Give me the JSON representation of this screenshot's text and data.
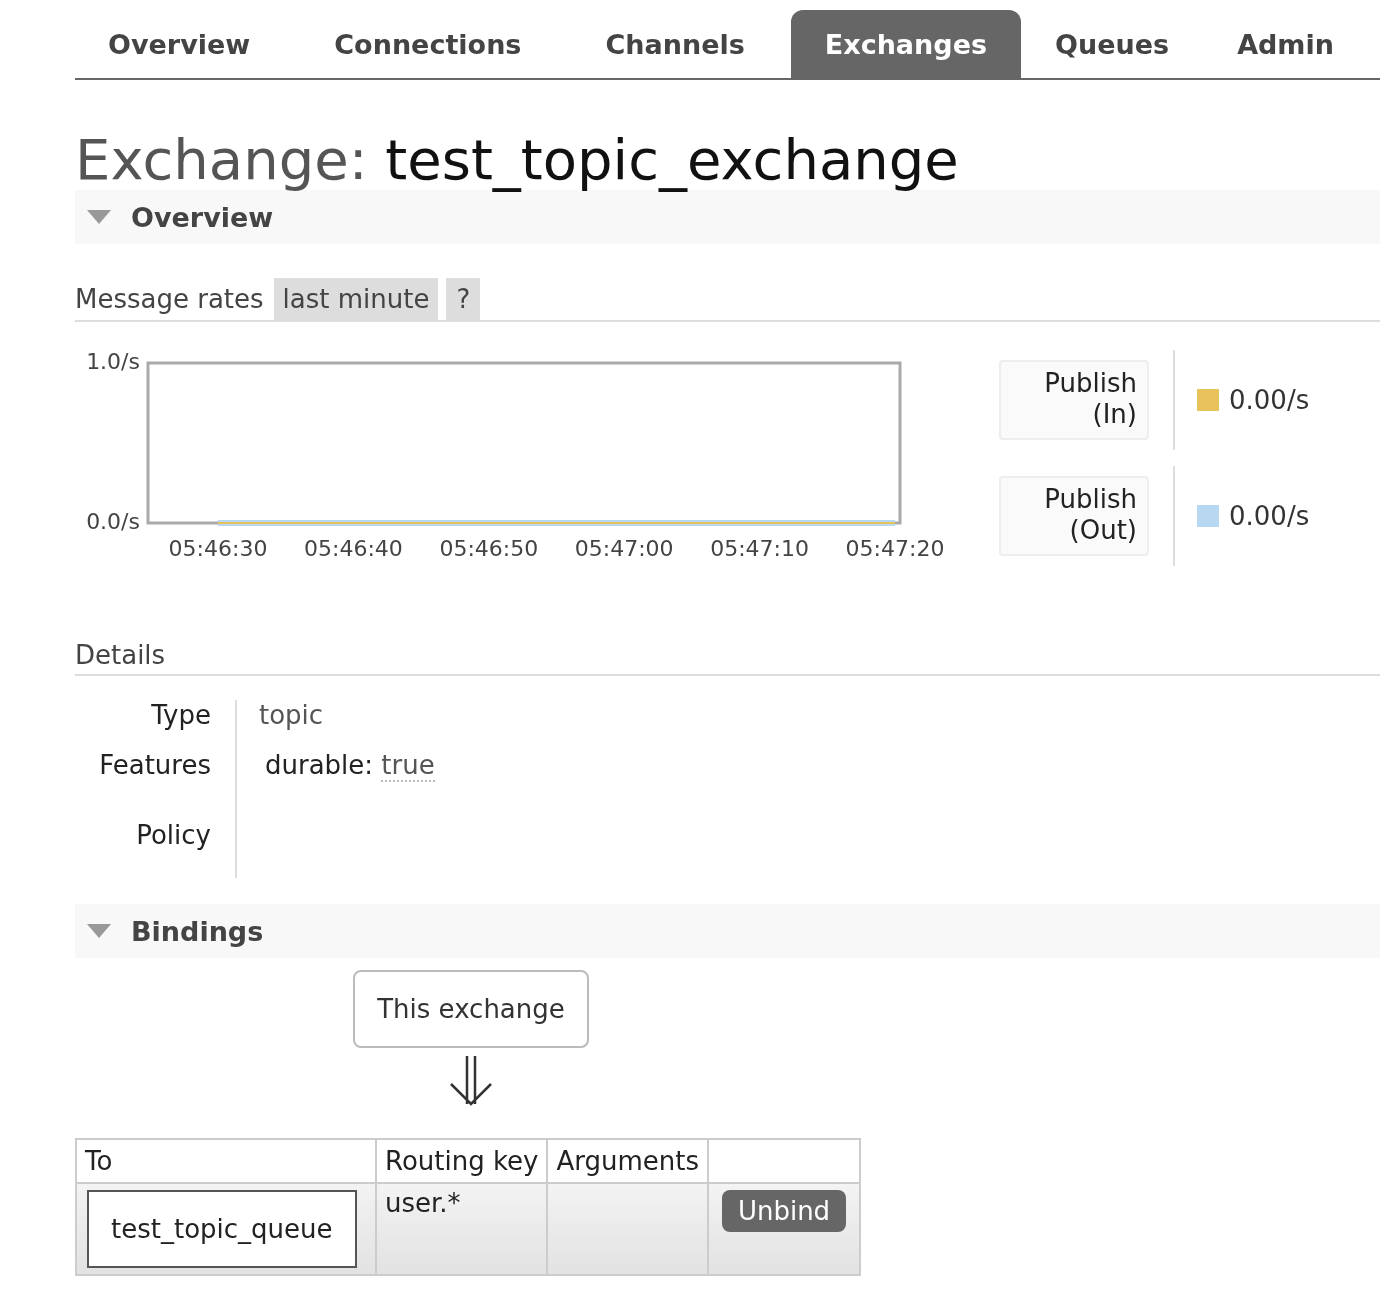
{
  "tabs": [
    {
      "label": "Overview",
      "selected": false
    },
    {
      "label": "Connections",
      "selected": false
    },
    {
      "label": "Channels",
      "selected": false
    },
    {
      "label": "Exchanges",
      "selected": true
    },
    {
      "label": "Queues",
      "selected": false
    },
    {
      "label": "Admin",
      "selected": false
    }
  ],
  "title": {
    "prefix": "Exchange:",
    "name": "test_topic_exchange"
  },
  "overview": {
    "heading": "Overview",
    "expanded": true,
    "rates_label": "Message rates",
    "range_button": "last minute",
    "help_button": "?",
    "chart_data": {
      "type": "line",
      "x": [
        "05:46:30",
        "05:46:40",
        "05:46:50",
        "05:47:00",
        "05:47:10",
        "05:47:20"
      ],
      "ylim": [
        0,
        1
      ],
      "yticks": [
        {
          "value": 0,
          "label": "0.0/s"
        },
        {
          "value": 1,
          "label": "1.0/s"
        }
      ],
      "series": [
        {
          "name": "Publish (In)",
          "color": "#e8c25a",
          "values": [
            0,
            0,
            0,
            0,
            0,
            0
          ]
        },
        {
          "name": "Publish (Out)",
          "color": "#b8d8f2",
          "values": [
            0,
            0,
            0,
            0,
            0,
            0
          ]
        }
      ]
    },
    "legend": [
      {
        "rate": "0.00/s"
      },
      {
        "rate": "0.00/s"
      }
    ]
  },
  "details": {
    "heading": "Details",
    "type_label": "Type",
    "type_value": "topic",
    "features_label": "Features",
    "feature_key": "durable:",
    "feature_value": "true",
    "policy_label": "Policy"
  },
  "bindings": {
    "heading": "Bindings",
    "expanded": true,
    "source": "This exchange",
    "columns": [
      "To",
      "Routing key",
      "Arguments"
    ],
    "rows": [
      {
        "to": "test_topic_queue",
        "routing_key": "user.*",
        "unbind": "Unbind"
      }
    ]
  }
}
